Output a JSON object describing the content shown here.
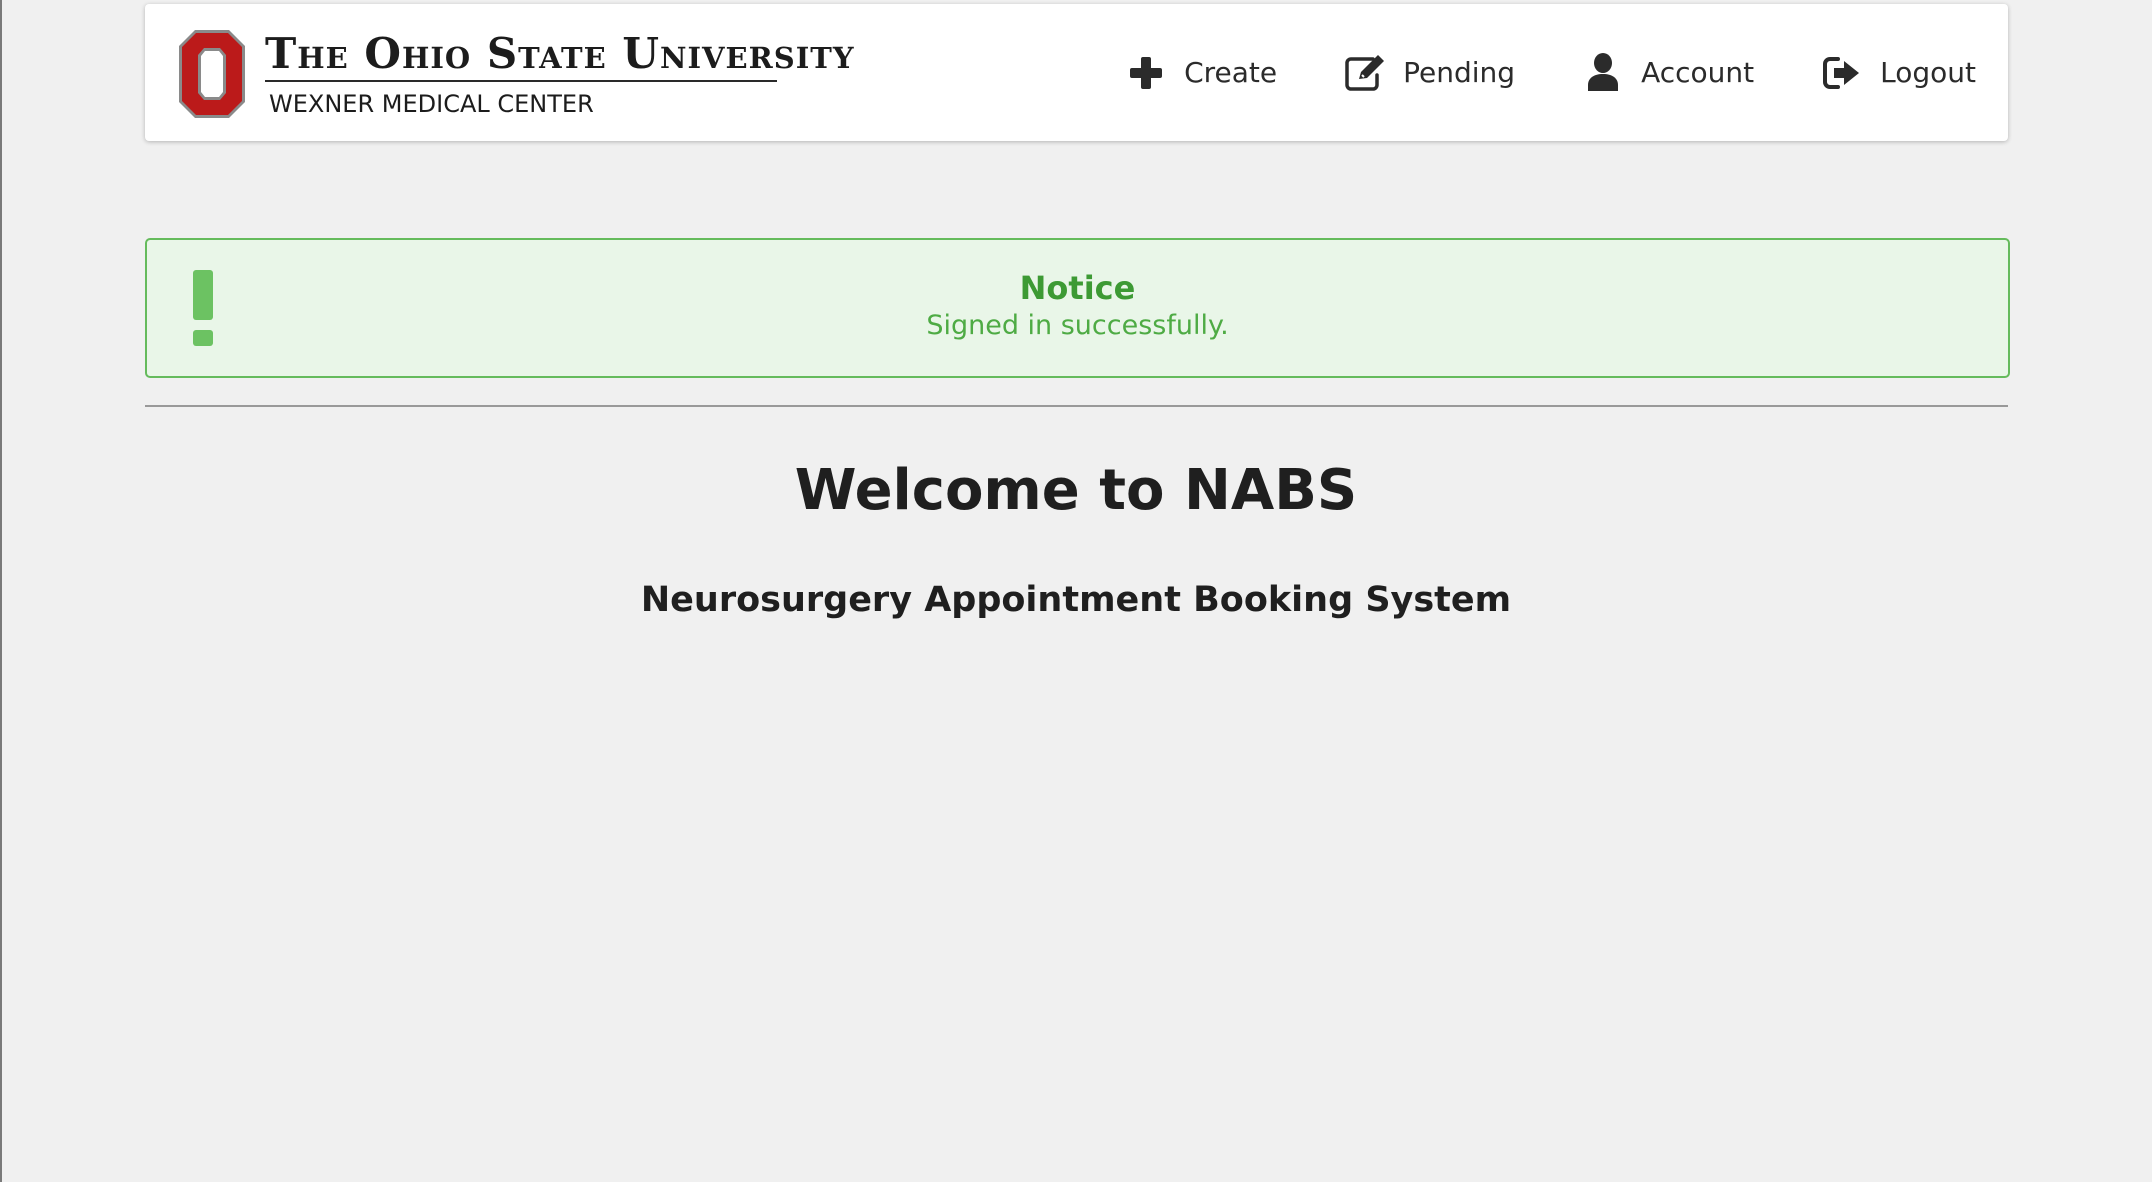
{
  "header": {
    "logo": {
      "title": "The Ohio State University",
      "subtitle": "WEXNER MEDICAL CENTER",
      "icon": "block-o-icon"
    },
    "nav": [
      {
        "label": "Create",
        "icon": "plus-icon"
      },
      {
        "label": "Pending",
        "icon": "edit-icon"
      },
      {
        "label": "Account",
        "icon": "user-icon"
      },
      {
        "label": "Logout",
        "icon": "logout-icon"
      }
    ]
  },
  "notice": {
    "title": "Notice",
    "message": "Signed in successfully.",
    "icon": "exclamation-icon",
    "color": "#65bb5c"
  },
  "main": {
    "heading": "Welcome to NABS",
    "subheading": "Neurosurgery Appointment Booking System"
  },
  "colors": {
    "brand_red": "#bb1a1a",
    "background": "#f0f0f0",
    "success_green": "#4eab44"
  }
}
